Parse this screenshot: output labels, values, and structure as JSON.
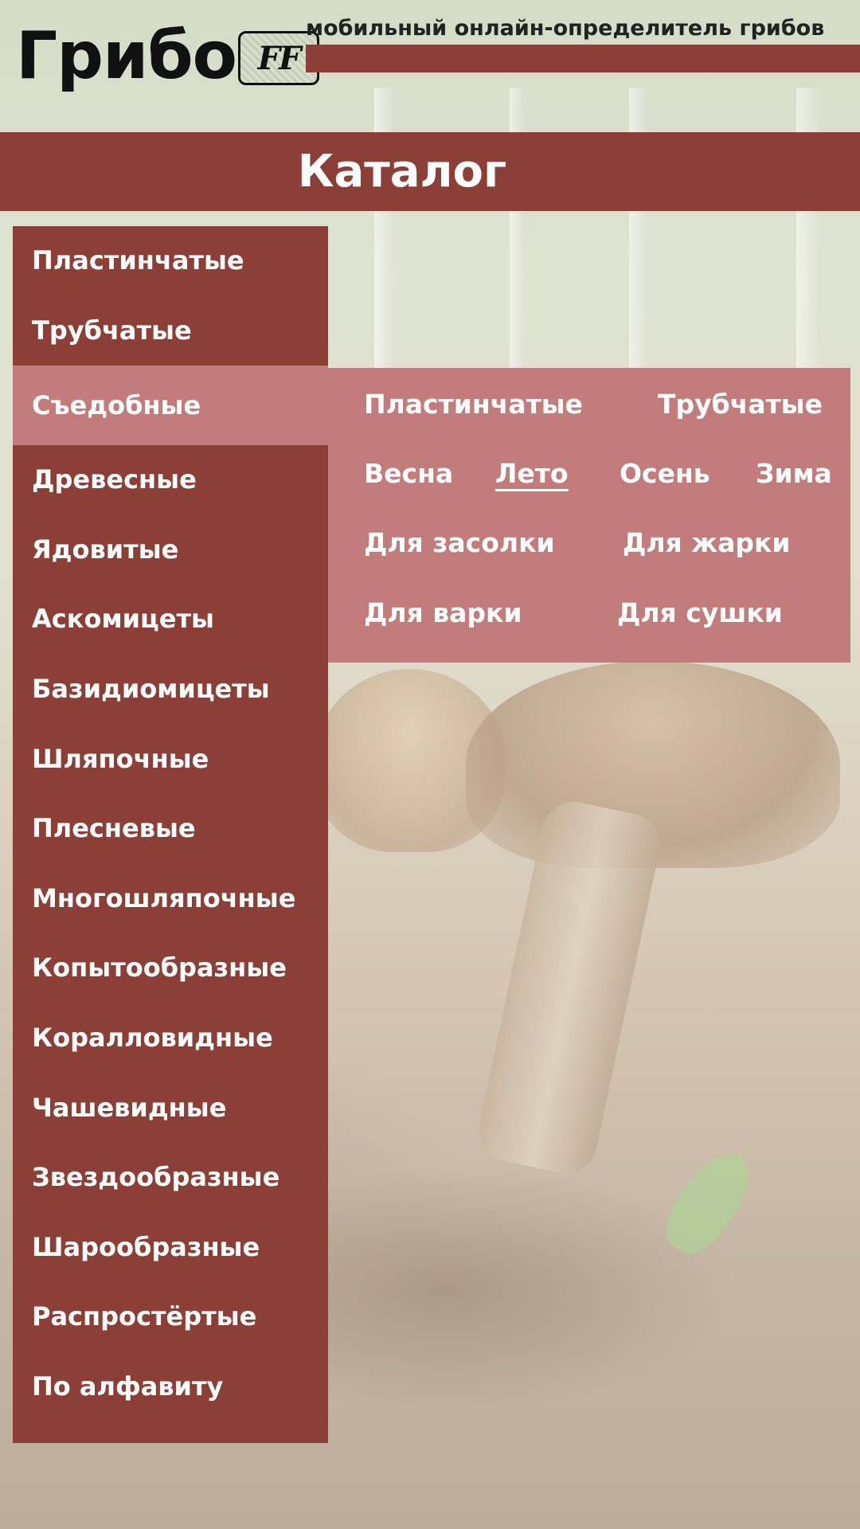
{
  "header": {
    "logo_text": "Грибо",
    "logo_mark_text": "FF",
    "tagline": "мобильный онлайн-определитель грибов"
  },
  "page": {
    "title": "Каталог"
  },
  "menu": {
    "items": [
      {
        "label": "Пластинчатые"
      },
      {
        "label": "Трубчатые"
      },
      {
        "label": "Съедобные",
        "active": true
      },
      {
        "label": "Древесные"
      },
      {
        "label": "Ядовитые"
      },
      {
        "label": "Аскомицеты"
      },
      {
        "label": "Базидиомицеты"
      },
      {
        "label": "Шляпочные"
      },
      {
        "label": "Плесневые"
      },
      {
        "label": "Многошляпочные"
      },
      {
        "label": "Копытообразные"
      },
      {
        "label": "Коралловидные"
      },
      {
        "label": "Чашевидные"
      },
      {
        "label": "Звездообразные"
      },
      {
        "label": "Шарообразные"
      },
      {
        "label": "Распростёртые"
      },
      {
        "label": "По алфавиту"
      }
    ]
  },
  "submenu": {
    "type_row": [
      "Пластинчатые",
      "Трубчатые"
    ],
    "season_row": [
      "Весна",
      "Лето",
      "Осень",
      "Зима"
    ],
    "selected_season": "Лето",
    "use_row_1": [
      "Для засолки",
      "Для жарки"
    ],
    "use_row_2": [
      "Для варки",
      "Для сушки"
    ]
  },
  "colors": {
    "brand": "#8b3f36",
    "highlight": "#c27c7b",
    "text_on_brand": "#ffffff"
  }
}
